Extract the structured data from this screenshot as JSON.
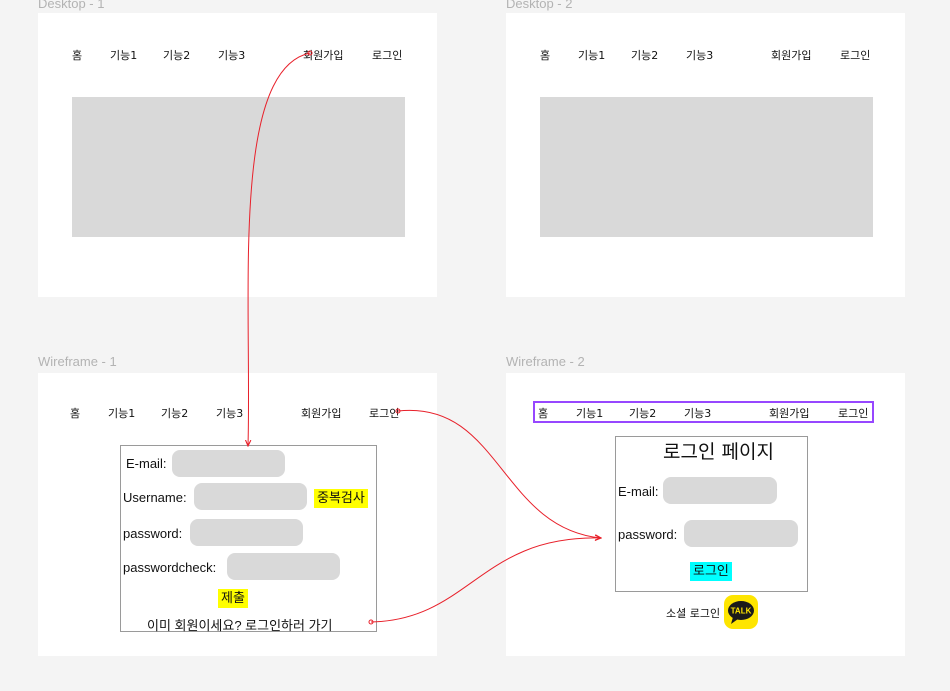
{
  "frames": {
    "desktop1": {
      "title": "Desktop - 1"
    },
    "desktop2": {
      "title": "Desktop - 2"
    },
    "wireframe1": {
      "title": "Wireframe - 1"
    },
    "wireframe2": {
      "title": "Wireframe - 2"
    }
  },
  "nav": {
    "home": "홈",
    "feature1": "기능1",
    "feature2": "기능2",
    "feature3": "기능3",
    "signup": "회원가입",
    "login": "로그인"
  },
  "signup_form": {
    "email_label": "E-mail:",
    "username_label": "Username:",
    "dup_check": "중복검사",
    "password_label": "password:",
    "password_check_label": "passwordcheck:",
    "submit": "제출",
    "already_member": "이미 회원이세요? 로그인하러 가기"
  },
  "login_page": {
    "title": "로그인 페이지",
    "email_label": "E-mail:",
    "password_label": "password:",
    "login_button": "로그인",
    "social_login": "소셜 로그인",
    "kakao_icon_text": "TALK"
  },
  "colors": {
    "highlight_yellow": "#ffff00",
    "highlight_cyan": "#00ffff",
    "selection_purple": "#9747ff",
    "connector_red": "#e8202a",
    "placeholder_gray": "#d9d9d9"
  }
}
